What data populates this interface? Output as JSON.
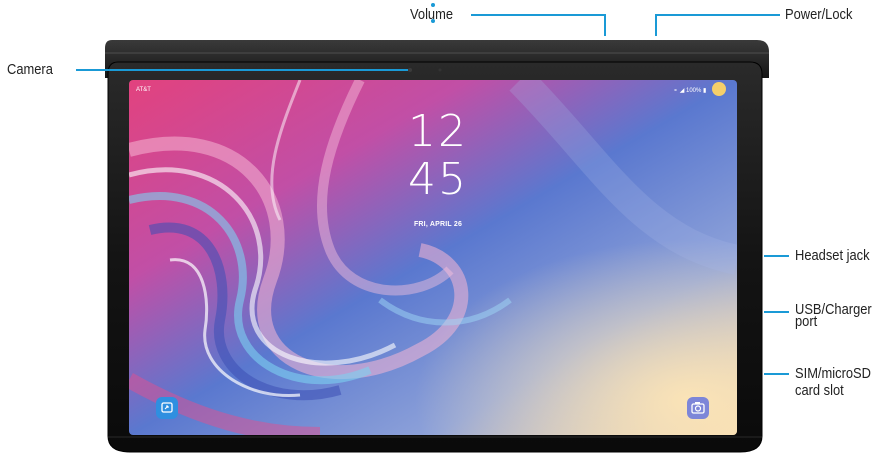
{
  "labels": {
    "volume": "Volume",
    "power_lock": "Power/Lock",
    "camera": "Camera",
    "headset_jack": "Headset jack",
    "usb_charger_line1": "USB/Charger",
    "usb_charger_line2": "port",
    "sim_line1": "SIM/microSD",
    "sim_line2": "card slot"
  },
  "screen": {
    "carrier": "AT&T",
    "status_icons": "⚬ ◢ 100% ▮",
    "clock_hour": "12",
    "clock_minute": "45",
    "date": "FRI, APRIL 26"
  },
  "icons": {
    "left_app": "smart-view-icon",
    "right_app": "camera-icon"
  },
  "colors": {
    "leader_line": "#1a9ad6",
    "device_body": "#1e1e1e",
    "left_app_bg": "#2f8fe0",
    "right_app_bg": "#7d86d8"
  }
}
